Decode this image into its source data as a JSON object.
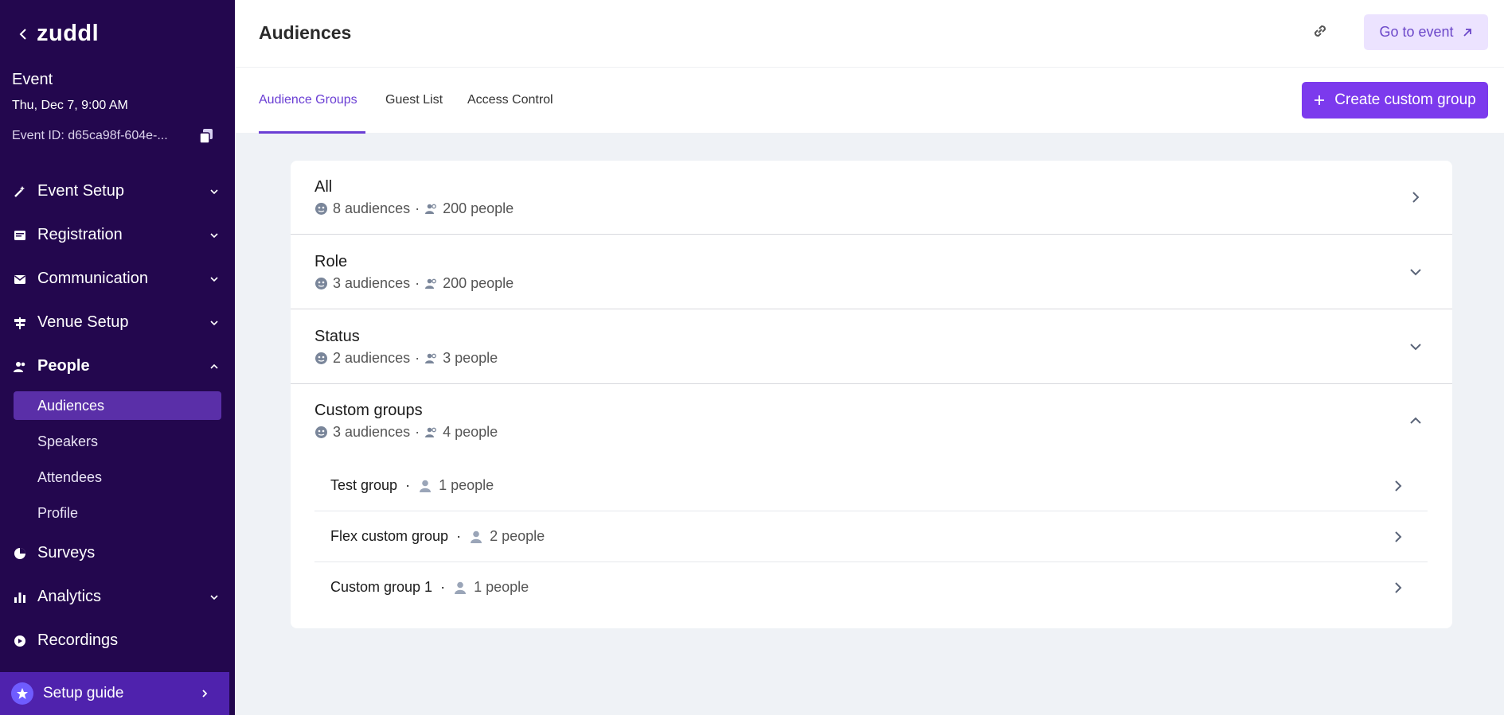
{
  "app": {
    "logo": "zuddl"
  },
  "event": {
    "name": "Event",
    "date": "Thu, Dec 7, 9:00 AM",
    "id": "Event ID: d65ca98f-604e-..."
  },
  "nav": {
    "event_setup": "Event Setup",
    "registration": "Registration",
    "communication": "Communication",
    "venue_setup": "Venue Setup",
    "people": "People",
    "people_sub": [
      "Audiences",
      "Speakers",
      "Attendees",
      "Profile"
    ],
    "surveys": "Surveys",
    "analytics": "Analytics",
    "recordings": "Recordings"
  },
  "setup_guide": "Setup guide",
  "header": {
    "title": "Audiences",
    "goto": "Go to event"
  },
  "tabs": [
    "Audience Groups",
    "Guest List",
    "Access Control"
  ],
  "create_btn": "Create custom group",
  "groups": [
    {
      "name": "All",
      "audiences": "8 audiences",
      "people": "200 people"
    },
    {
      "name": "Role",
      "audiences": "3 audiences",
      "people": "200 people"
    },
    {
      "name": "Status",
      "audiences": "2 audiences",
      "people": "3 people"
    },
    {
      "name": "Custom groups",
      "audiences": "3 audiences",
      "people": "4 people"
    }
  ],
  "custom_groups": [
    {
      "name": "Test group",
      "people": "1 people"
    },
    {
      "name": "Flex custom group",
      "people": "2 people"
    },
    {
      "name": "Custom group 1",
      "people": "1 people"
    }
  ],
  "colors": {
    "sidebar": "#23074e",
    "accent": "#7c3aed",
    "active_nav": "#5a2fa8"
  }
}
